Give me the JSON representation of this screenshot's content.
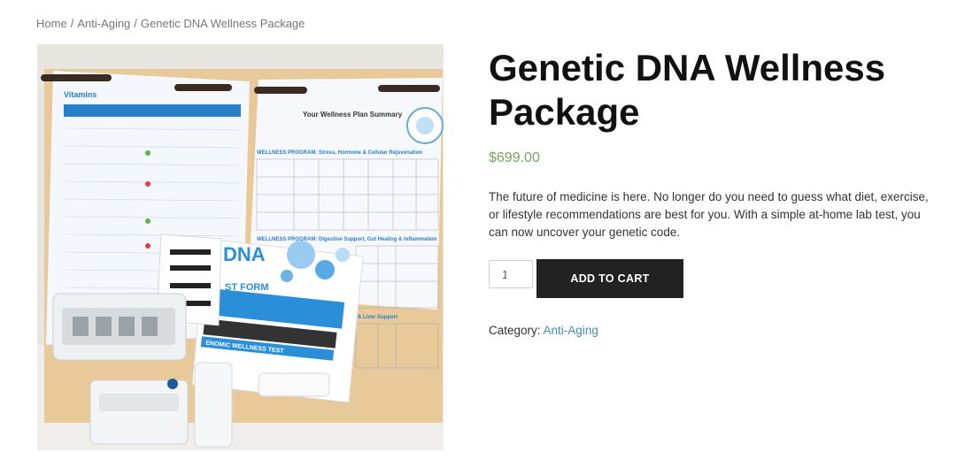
{
  "breadcrumb": {
    "home": "Home",
    "category": "Anti-Aging",
    "current": "Genetic DNA Wellness Package",
    "separator": "/"
  },
  "product": {
    "title": "Genetic DNA Wellness Package",
    "price": "$699.00",
    "description": "The future of medicine is here. No longer do you need to guess what diet, exercise, or lifestyle recommendations are best for you. With a simple at-home lab test, you can now uncover your genetic code.",
    "quantity": "1",
    "add_to_cart_label": "ADD TO CART",
    "category_label": "Category:",
    "category_value": "Anti-Aging"
  },
  "image_text": {
    "folder_left_heading": "Vitamins",
    "folder_right_heading": "Your Wellness Plan Summary",
    "section_1": "WELLNESS PROGRAM: Stress, Hormone & Cellular Rejuvenation",
    "section_2": "WELLNESS PROGRAM: Digestive Support, Gut Healing & Inflammation",
    "section_3": "& Liver Support",
    "kit_brand": "DNA",
    "kit_form": "ST FORM",
    "kit_banner": "ENOMIC WELLNESS TEST"
  },
  "colors": {
    "price": "#77a464",
    "link": "#4a8cb8",
    "button_bg": "#222222",
    "accent_blue": "#2a8fd8"
  }
}
